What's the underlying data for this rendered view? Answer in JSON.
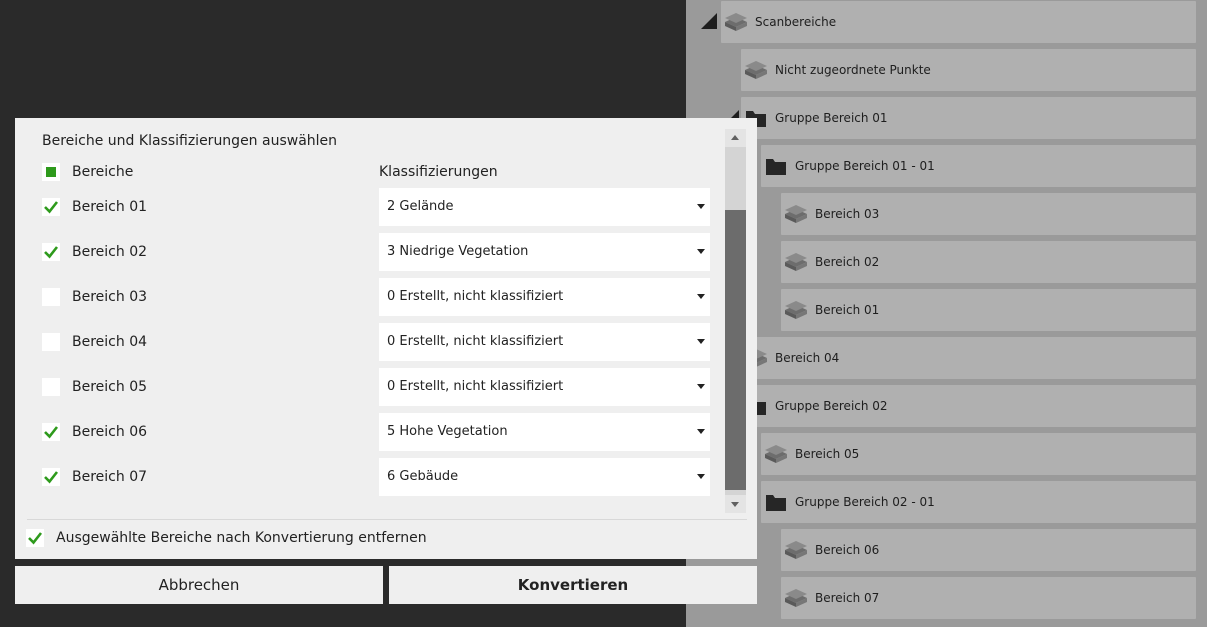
{
  "tree": {
    "items": [
      {
        "label": "Scanbereiche",
        "icon": "layers-icon"
      },
      {
        "label": "Nicht zugeordnete Punkte",
        "icon": "layers-icon"
      },
      {
        "label": "Gruppe Bereich 01",
        "icon": "folder-icon"
      },
      {
        "label": "Gruppe Bereich 01 -  01",
        "icon": "folder-icon"
      },
      {
        "label": "Bereich 03",
        "icon": "layers-icon"
      },
      {
        "label": "Bereich 02",
        "icon": "layers-icon"
      },
      {
        "label": "Bereich 01",
        "icon": "layers-icon"
      },
      {
        "label": "Bereich 04",
        "icon": "layers-icon"
      },
      {
        "label": "Gruppe Bereich 02",
        "icon": "folder-icon"
      },
      {
        "label": "Bereich 05",
        "icon": "layers-icon"
      },
      {
        "label": "Gruppe Bereich 02 -  01",
        "icon": "folder-icon"
      },
      {
        "label": "Bereich 06",
        "icon": "layers-icon"
      },
      {
        "label": "Bereich 07",
        "icon": "layers-icon"
      }
    ]
  },
  "dialog": {
    "title": "Bereiche und Klassifizierungen auswählen",
    "col_areas": "Bereiche",
    "col_classes": "Klassifizierungen",
    "header_check_state": "partial",
    "rows": [
      {
        "label": "Bereich 01",
        "checked": true,
        "classification": "2 Gelände"
      },
      {
        "label": "Bereich 02",
        "checked": true,
        "classification": "3 Niedrige Vegetation"
      },
      {
        "label": "Bereich 03",
        "checked": false,
        "classification": "0 Erstellt, nicht klassifiziert"
      },
      {
        "label": "Bereich 04",
        "checked": false,
        "classification": "0 Erstellt, nicht klassifiziert"
      },
      {
        "label": "Bereich 05",
        "checked": false,
        "classification": "0 Erstellt, nicht klassifiziert"
      },
      {
        "label": "Bereich 06",
        "checked": true,
        "classification": "5 Hohe Vegetation"
      },
      {
        "label": "Bereich 07",
        "checked": true,
        "classification": "6 Gebäude"
      }
    ],
    "remove_after_convert": {
      "label": "Ausgewählte Bereiche nach Konvertierung entfernen",
      "checked": true
    }
  },
  "buttons": {
    "cancel": "Abbrechen",
    "convert": "Konvertieren"
  },
  "colors": {
    "check": "#2e9a1c",
    "panel": "#9a9a9a",
    "row": "#b0b0b0"
  }
}
